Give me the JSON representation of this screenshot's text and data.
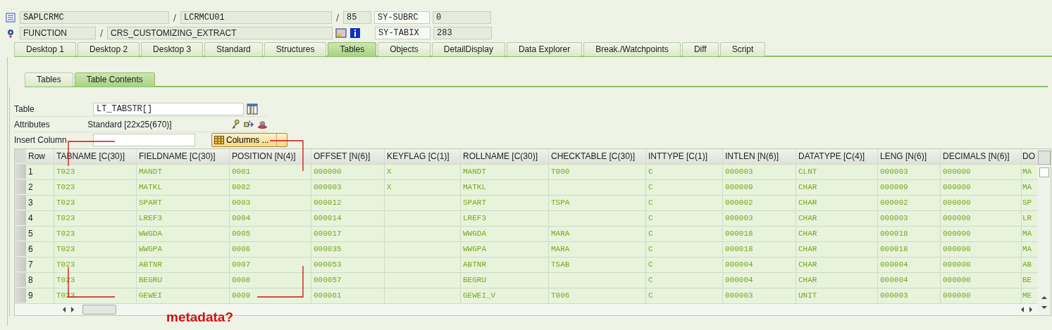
{
  "header": {
    "program": "SAPLCRMC",
    "separator_1": "/",
    "include": "LCRMCU01",
    "separator_2": "/",
    "line": "85",
    "subrc_label": "SY-SUBRC",
    "subrc_value": "0",
    "event_type": "FUNCTION",
    "separator_3": "/",
    "event_name": "CRS_CUSTOMIZING_EXTRACT",
    "tabix_label": "SY-TABIX",
    "tabix_value": "283"
  },
  "main_tabs": [
    {
      "label": "Desktop 1",
      "selected": false
    },
    {
      "label": "Desktop 2",
      "selected": false
    },
    {
      "label": "Desktop 3",
      "selected": false
    },
    {
      "label": "Standard",
      "selected": false
    },
    {
      "label": "Structures",
      "selected": false
    },
    {
      "label": "Tables",
      "selected": true
    },
    {
      "label": "Objects",
      "selected": false
    },
    {
      "label": "DetailDisplay",
      "selected": false
    },
    {
      "label": "Data Explorer",
      "selected": false
    },
    {
      "label": "Break./Watchpoints",
      "selected": false
    },
    {
      "label": "Diff",
      "selected": false
    },
    {
      "label": "Script",
      "selected": false
    }
  ],
  "sub_tabs": [
    {
      "label": "Tables",
      "selected": false
    },
    {
      "label": "Table Contents",
      "selected": true
    }
  ],
  "form": {
    "table_label": "Table",
    "table_value": "LT_TABSTR[]",
    "attributes_label": "Attributes",
    "attributes_value": "Standard [22x25(670)]",
    "insert_label": "Insert Column",
    "columns_button": "Columns ..."
  },
  "table": {
    "row_header": "Row",
    "columns": [
      "TABNAME [C(30)]",
      "FIELDNAME [C(30)]",
      "POSITION [N(4)]",
      "OFFSET [N(6)]",
      "KEYFLAG [C(1)]",
      "ROLLNAME [C(30)]",
      "CHECKTABLE [C(30)]",
      "INTTYPE [C(1)]",
      "INTLEN [N(6)]",
      "DATATYPE [C(4)]",
      "LENG [N(6)]",
      "DECIMALS [N(6)]",
      "DO"
    ],
    "rows": [
      {
        "row": "1",
        "cells": [
          "T023",
          "MANDT",
          "0001",
          "000000",
          "X",
          "MANDT",
          "T000",
          "C",
          "000003",
          "CLNT",
          "000003",
          "000000",
          "MA"
        ]
      },
      {
        "row": "2",
        "cells": [
          "T023",
          "MATKL",
          "0002",
          "000003",
          "X",
          "MATKL",
          "",
          "C",
          "000009",
          "CHAR",
          "000009",
          "000000",
          "MA"
        ]
      },
      {
        "row": "3",
        "cells": [
          "T023",
          "SPART",
          "0003",
          "000012",
          "",
          "SPART",
          "TSPA",
          "C",
          "000002",
          "CHAR",
          "000002",
          "000000",
          "SP"
        ]
      },
      {
        "row": "4",
        "cells": [
          "T023",
          "LREF3",
          "0004",
          "000014",
          "",
          "LREF3",
          "",
          "C",
          "000003",
          "CHAR",
          "000003",
          "000000",
          "LR"
        ]
      },
      {
        "row": "5",
        "cells": [
          "T023",
          "WWGDA",
          "0005",
          "000017",
          "",
          "WWGDA",
          "MARA",
          "C",
          "000018",
          "CHAR",
          "000018",
          "000000",
          "MA"
        ]
      },
      {
        "row": "6",
        "cells": [
          "T023",
          "WWGPA",
          "0006",
          "000035",
          "",
          "WWGPA",
          "MARA",
          "C",
          "000018",
          "CHAR",
          "000018",
          "000000",
          "MA"
        ]
      },
      {
        "row": "7",
        "cells": [
          "T023",
          "ABTNR",
          "0007",
          "000053",
          "",
          "ABTNR",
          "TSAB",
          "C",
          "000004",
          "CHAR",
          "000004",
          "000000",
          "AB"
        ]
      },
      {
        "row": "8",
        "cells": [
          "T023",
          "BEGRU",
          "0008",
          "000057",
          "",
          "BEGRU",
          "",
          "C",
          "000004",
          "CHAR",
          "000004",
          "000000",
          "BE"
        ]
      },
      {
        "row": "9",
        "cells": [
          "T023",
          "GEWEI",
          "0009",
          "000061",
          "",
          "GEWEI_V",
          "T006",
          "C",
          "000003",
          "UNIT",
          "000003",
          "000000",
          "ME"
        ]
      }
    ]
  },
  "annotation": {
    "note": "metadata?"
  }
}
